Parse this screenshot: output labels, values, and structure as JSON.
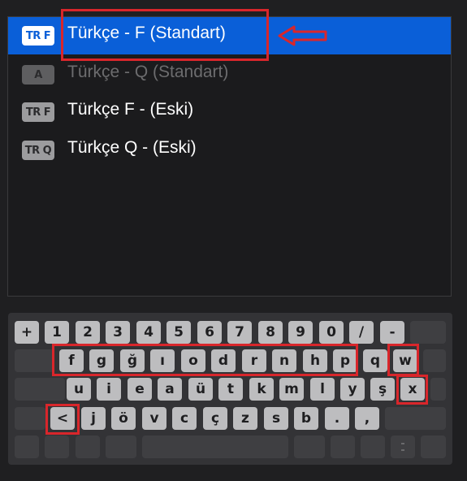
{
  "input_sources": [
    {
      "badge": "TR F",
      "label": "Türkçe - F (Standart)",
      "selected": true,
      "disabled": false
    },
    {
      "badge": "A",
      "label": "Türkçe - Q (Standart)",
      "selected": false,
      "disabled": true
    },
    {
      "badge": "TR F",
      "label": "Türkçe F - (Eski)",
      "selected": false,
      "disabled": false
    },
    {
      "badge": "TR Q",
      "label": "Türkçe Q - (Eski)",
      "selected": false,
      "disabled": false
    }
  ],
  "keyboard": {
    "row1": [
      "+",
      "1",
      "2",
      "3",
      "4",
      "5",
      "6",
      "7",
      "8",
      "9",
      "0",
      "/",
      "-"
    ],
    "row2": [
      "f",
      "g",
      "ğ",
      "ı",
      "o",
      "d",
      "r",
      "n",
      "h",
      "p",
      "q",
      "w"
    ],
    "row3": [
      "u",
      "i",
      "e",
      "a",
      "ü",
      "t",
      "k",
      "m",
      "l",
      "y",
      "ş",
      "x"
    ],
    "row4": [
      "<",
      "j",
      "ö",
      "v",
      "c",
      "ç",
      "z",
      "s",
      "b",
      ".",
      ","
    ]
  },
  "colors": {
    "selection": "#0a5fd8",
    "highlight": "#d9262b",
    "key_lit": "#bdbdbf",
    "key_blank": "#3f3f42"
  }
}
